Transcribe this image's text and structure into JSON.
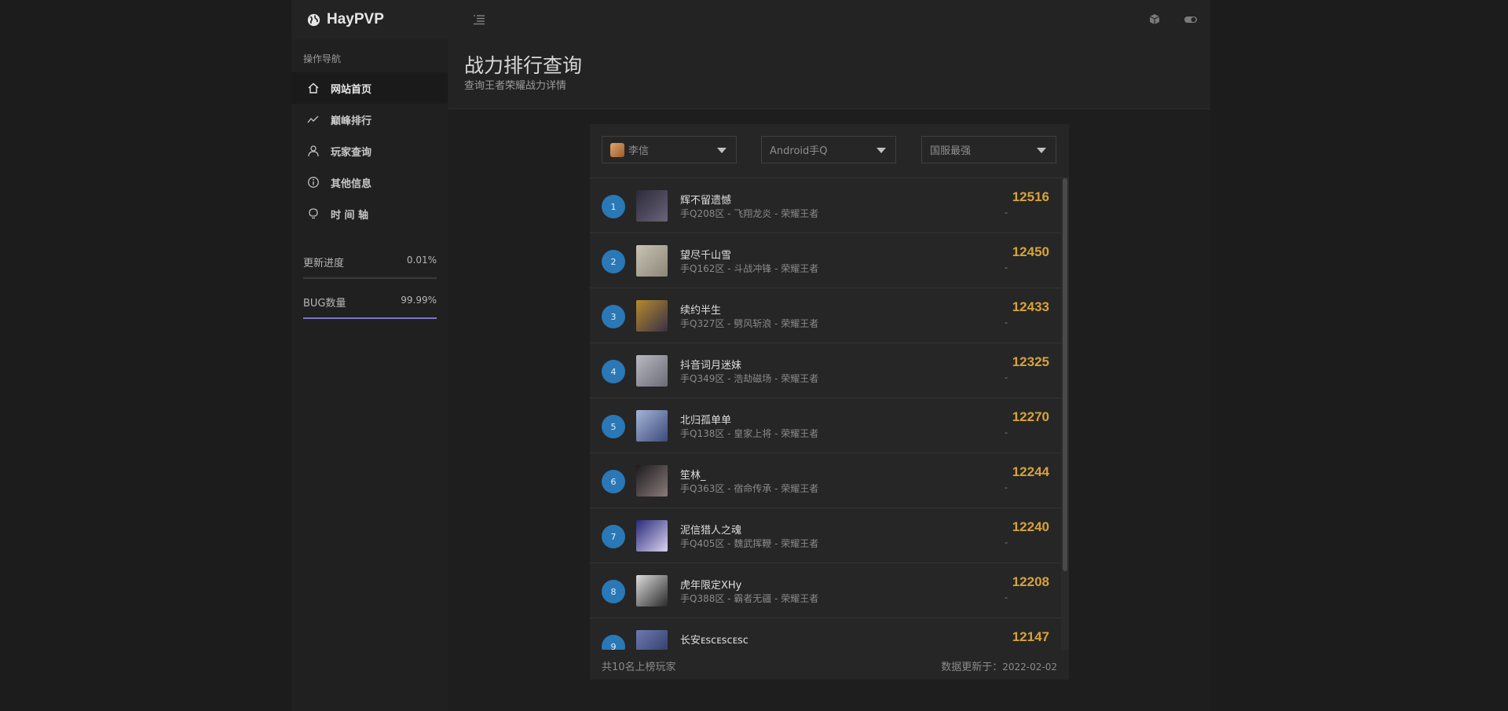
{
  "brand": {
    "name": "HayPVP"
  },
  "sidebar": {
    "heading": "操作导航",
    "items": [
      {
        "label": "网站首页",
        "icon": "home-icon",
        "active": true
      },
      {
        "label": "巅峰排行",
        "icon": "trend-icon",
        "active": false
      },
      {
        "label": "玩家查询",
        "icon": "user-icon",
        "active": false
      },
      {
        "label": "其他信息",
        "icon": "info-icon",
        "active": false
      },
      {
        "label": "时 间 轴",
        "icon": "bulb-icon",
        "active": false
      }
    ],
    "progress": [
      {
        "label": "更新进度",
        "value": "0.01%",
        "fraction": 0.0001,
        "color": "#3d3d3d"
      },
      {
        "label": "BUG数量",
        "value": "99.99%",
        "fraction": 0.9999,
        "color": "#7d75c9"
      }
    ]
  },
  "page": {
    "title": "战力排行查询",
    "subtitle": "查询王者荣耀战力详情"
  },
  "filters": {
    "hero": "李信",
    "platform": "Android手Q",
    "scope": "国服最强"
  },
  "players": [
    {
      "rank": "1",
      "name": "辉不留遗憾",
      "info": "手Q208区 - 飞翔龙炎 - 荣耀王者",
      "score": "12516",
      "sub": "-",
      "avatar": [
        "#2b2a3a",
        "#6a6478"
      ]
    },
    {
      "rank": "2",
      "name": "望尽千山雪",
      "info": "手Q162区 - 斗战冲锋 - 荣耀王者",
      "score": "12450",
      "sub": "-",
      "avatar": [
        "#c9c3b4",
        "#8c8678"
      ]
    },
    {
      "rank": "3",
      "name": "续约半生",
      "info": "手Q327区 - 劈风斩浪 - 荣耀王者",
      "score": "12433",
      "sub": "-",
      "avatar": [
        "#b58a2c",
        "#3a3046"
      ]
    },
    {
      "rank": "4",
      "name": "抖音词月迷妹",
      "info": "手Q349区 - 浩劫磁场 - 荣耀王者",
      "score": "12325",
      "sub": "-",
      "avatar": [
        "#b9b9c2",
        "#6b6b76"
      ]
    },
    {
      "rank": "5",
      "name": "北归孤单单",
      "info": "手Q138区 - 皇家上将 - 荣耀王者",
      "score": "12270",
      "sub": "-",
      "avatar": [
        "#a5b5d8",
        "#3b4a7a"
      ]
    },
    {
      "rank": "6",
      "name": "笙林_",
      "info": "手Q363区 - 宿命传承 - 荣耀王者",
      "score": "12244",
      "sub": "-",
      "avatar": [
        "#1d1b1e",
        "#8a7b7a"
      ]
    },
    {
      "rank": "7",
      "name": "泥信猎人之魂",
      "info": "手Q405区 - 魏武挥鞭 - 荣耀王者",
      "score": "12240",
      "sub": "-",
      "avatar": [
        "#2a2a7a",
        "#d9d3f0"
      ]
    },
    {
      "rank": "8",
      "name": "虎年限定XHy",
      "info": "手Q388区 - 霸者无疆 - 荣耀王者",
      "score": "12208",
      "sub": "-",
      "avatar": [
        "#dcdcdc",
        "#2a2a2a"
      ]
    },
    {
      "rank": "9",
      "name": "长安ᴇsᴄᴇsᴄᴇsᴄ",
      "info": "",
      "score": "12147",
      "sub": "",
      "avatar": [
        "#6b7bb0",
        "#2a3560"
      ]
    }
  ],
  "footer": {
    "count_text": "共10名上榜玩家",
    "updated_label": "数据更新于：",
    "updated_date": "2022-02-02"
  }
}
